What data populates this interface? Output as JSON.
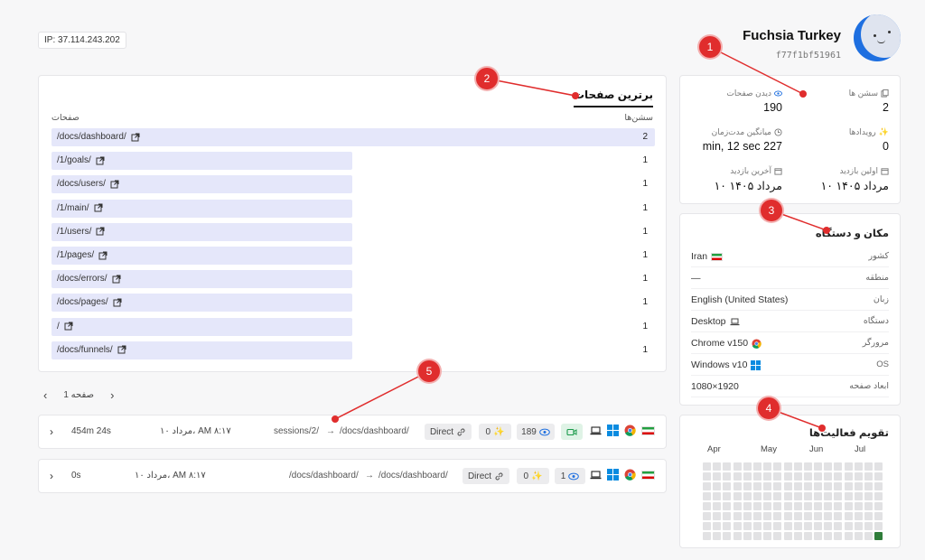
{
  "ip_label": "IP: 37.114.243.202",
  "profile": {
    "name": "Fuchsia Turkey",
    "id": "f77f1bf51961"
  },
  "stats": {
    "sessions_label": "سشن ها",
    "sessions_value": "2",
    "pageviews_label": "دیدن صفحات",
    "pageviews_value": "190",
    "events_label": "رویدادها",
    "events_value": "0",
    "avg_duration_label": "میانگین مدت‌زمان",
    "avg_duration_value": "min, 12 sec 227",
    "first_visit_label": "اولین بازدید",
    "first_visit_value": "۱۰ مرداد ۱۴۰۵",
    "last_visit_label": "آخرین بازدید",
    "last_visit_value": "۱۰ مرداد ۱۴۰۵"
  },
  "location": {
    "title": "مکان و دستگاه",
    "rows": [
      {
        "key": "کشور",
        "value": "Iran"
      },
      {
        "key": "منطقه",
        "value": "—"
      },
      {
        "key": "زبان",
        "value": "English (United States)"
      },
      {
        "key": "دستگاه",
        "value": "Desktop"
      },
      {
        "key": "مرورگر",
        "value": "Chrome v150"
      },
      {
        "key": "OS",
        "value": "Windows v10"
      },
      {
        "key": "ابعاد صفحه",
        "value": "1080×1920"
      }
    ]
  },
  "calendar": {
    "title": "تقویم فعالیت‌ها",
    "months": [
      "Apr",
      "May",
      "Jun",
      "Jul"
    ],
    "active_color": "#2f7d3a"
  },
  "top_pages": {
    "title": "برترین صفحات",
    "col_pages": "صفحات",
    "col_sessions": "سشن‌ها",
    "rows": [
      {
        "path": "/docs/dashboard/",
        "count": "2",
        "share": 1.0
      },
      {
        "path": "/1/goals/",
        "count": "1",
        "share": 0.5
      },
      {
        "path": "/docs/users/",
        "count": "1",
        "share": 0.5
      },
      {
        "path": "/1/main/",
        "count": "1",
        "share": 0.5
      },
      {
        "path": "/1/users/",
        "count": "1",
        "share": 0.5
      },
      {
        "path": "/1/pages/",
        "count": "1",
        "share": 0.5
      },
      {
        "path": "/docs/errors/",
        "count": "1",
        "share": 0.5
      },
      {
        "path": "/docs/pages/",
        "count": "1",
        "share": 0.5
      },
      {
        "path": "/",
        "count": "1",
        "share": 0.5
      },
      {
        "path": "/docs/funnels/",
        "count": "1",
        "share": 0.5
      }
    ]
  },
  "pagination": {
    "label": "صفحه 1"
  },
  "sessions": [
    {
      "duration": "454m 24s",
      "date": "۱۰ مرداد، AM ۸:۱۷",
      "from": "sessions/2/",
      "to": "/docs/dashboard/",
      "source": "Direct",
      "events": "0",
      "views": "189",
      "has_replay": true
    },
    {
      "duration": "0s",
      "date": "۱۰ مرداد، AM ۸:۱۷",
      "from": "/docs/dashboard/",
      "to": "/docs/dashboard/",
      "source": "Direct",
      "events": "0",
      "views": "1",
      "has_replay": false
    }
  ],
  "markers": [
    "1",
    "2",
    "3",
    "4",
    "5"
  ],
  "colors": {
    "accent": "#1e6fe0",
    "marker": "#e02d2d",
    "bar": "#e5e7fa"
  }
}
